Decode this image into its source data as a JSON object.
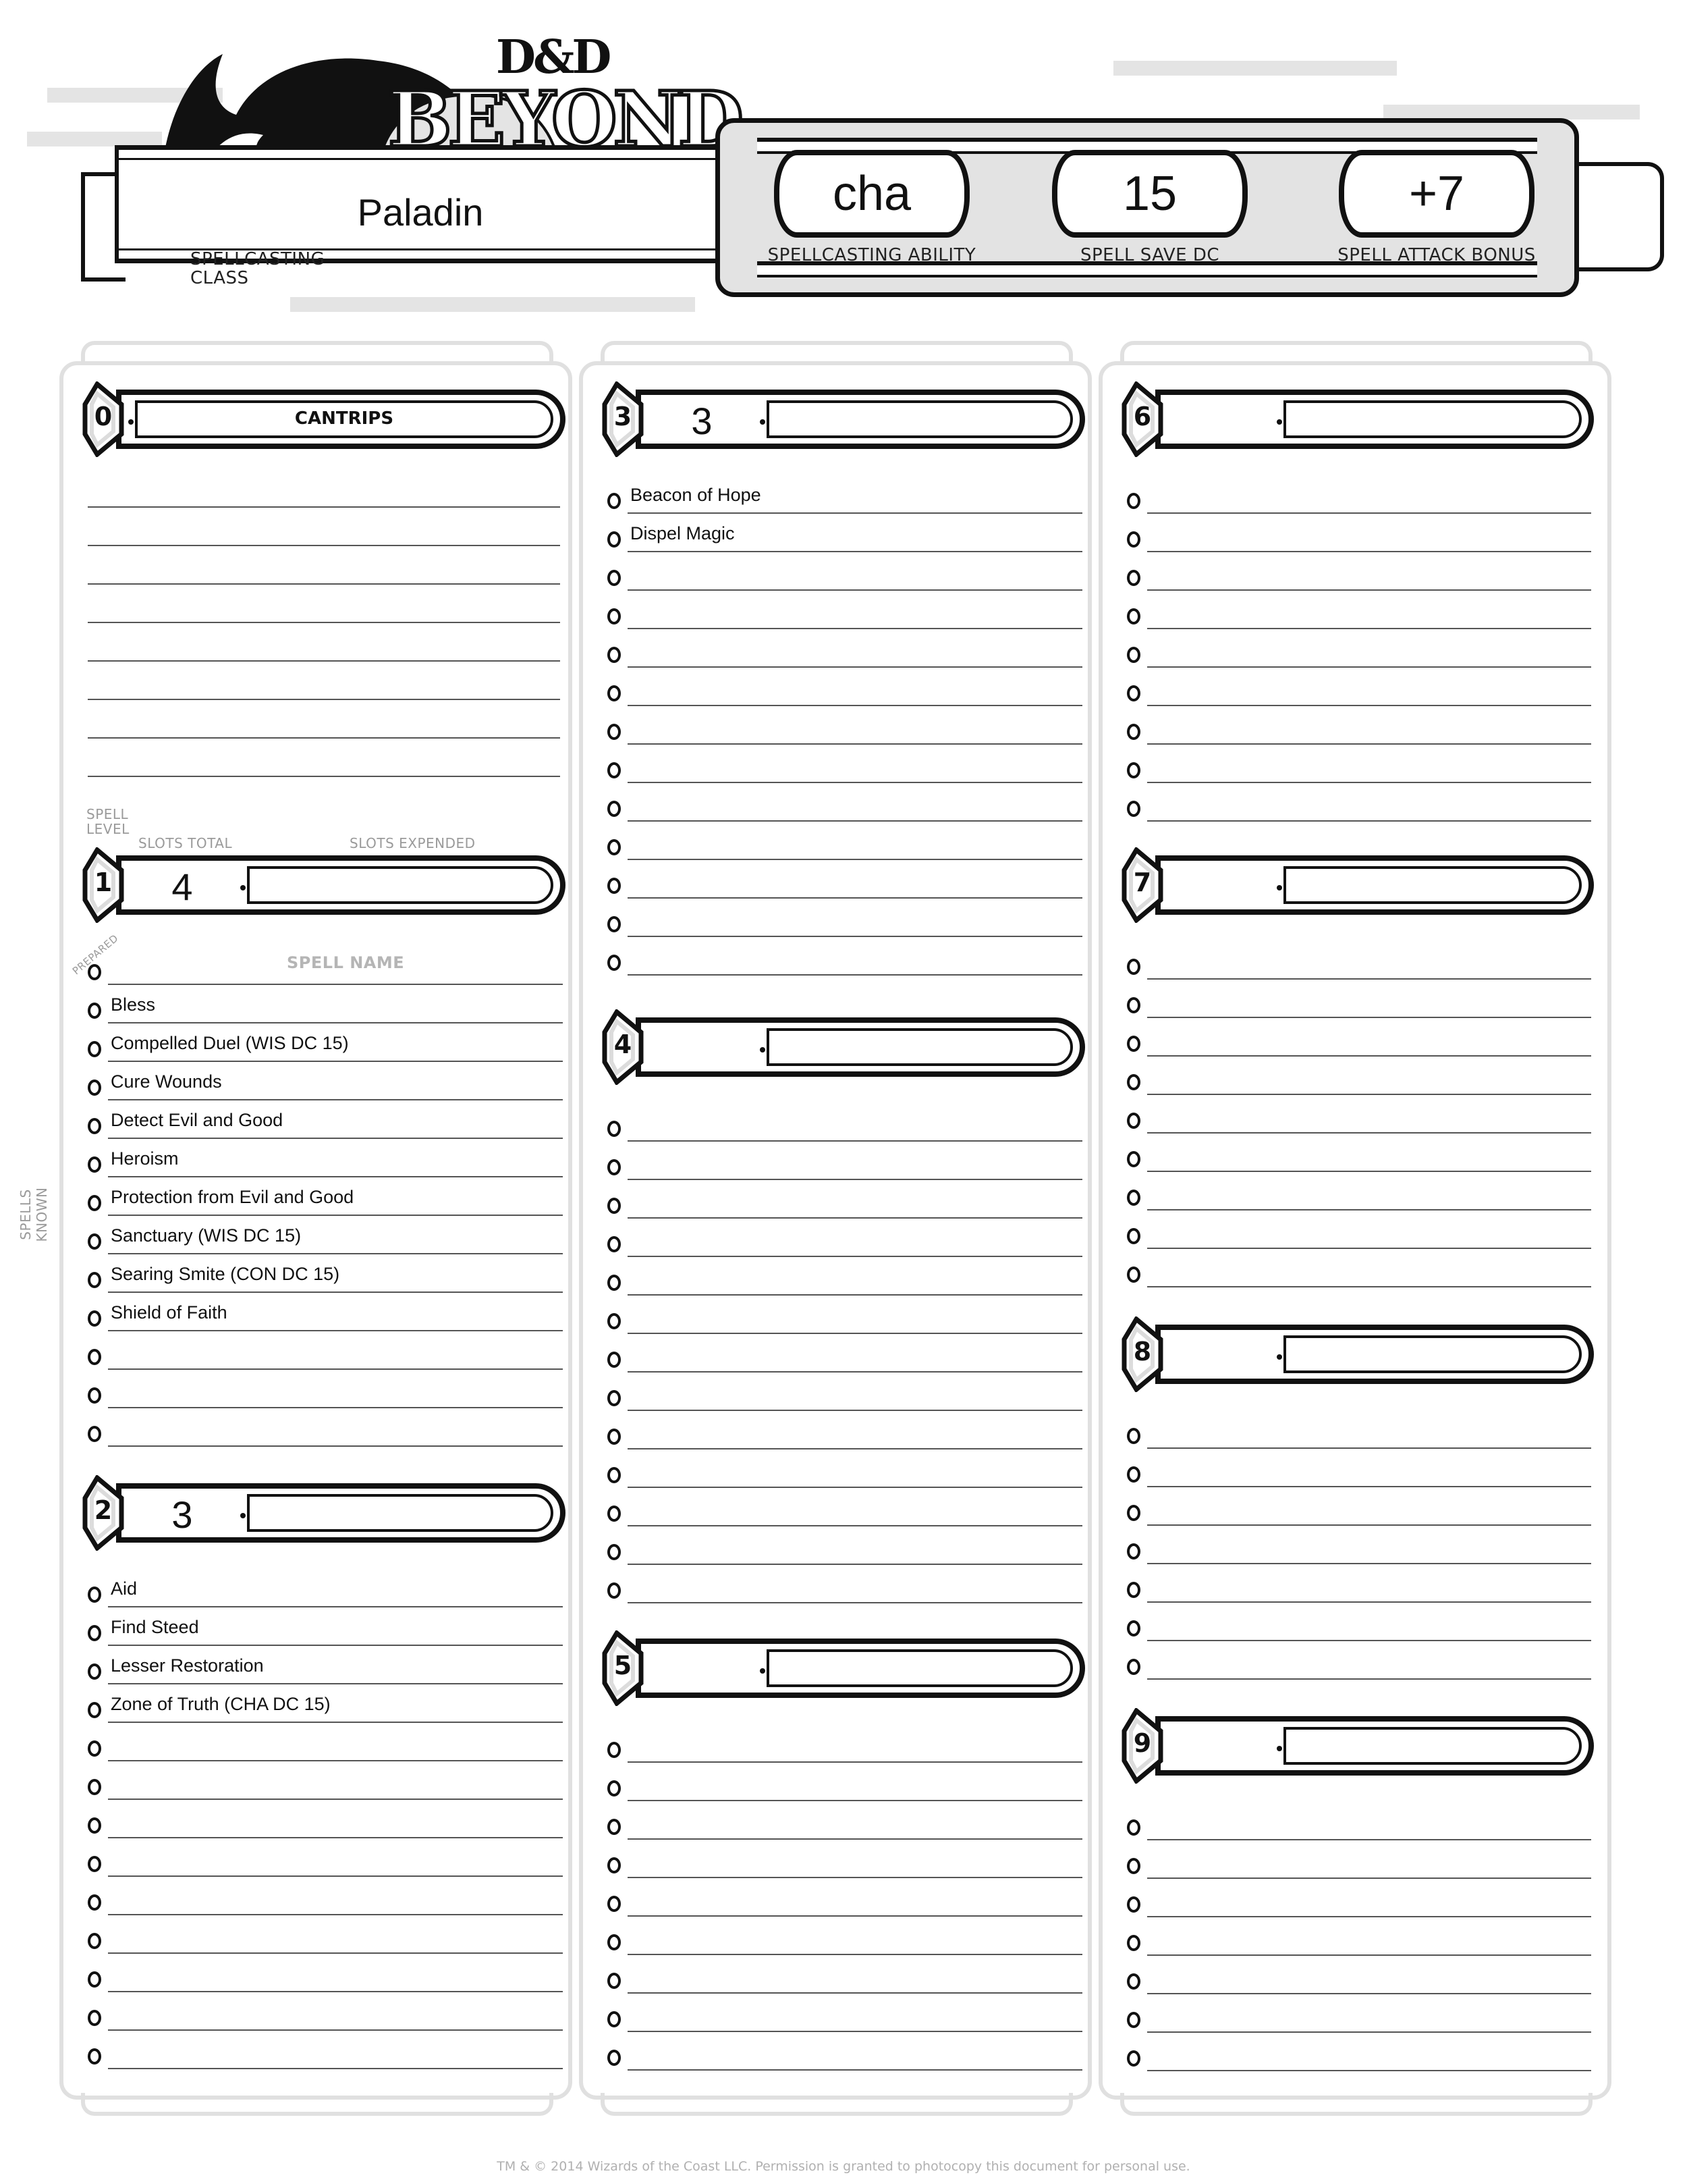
{
  "header": {
    "logo_top": "D&D",
    "logo_bottom": "BEYOND",
    "spellcasting_class": {
      "label": "SPELLCASTING CLASS",
      "value": "Paladin"
    },
    "stats": [
      {
        "label": "SPELLCASTING ABILITY",
        "value": "cha"
      },
      {
        "label": "SPELL SAVE DC",
        "value": "15"
      },
      {
        "label": "SPELL ATTACK BONUS",
        "value": "+7"
      }
    ]
  },
  "labels": {
    "spell_level": "SPELL LEVEL",
    "slots_total": "SLOTS TOTAL",
    "slots_expended": "SLOTS EXPENDED",
    "prepared": "PREPARED",
    "spell_name": "SPELL NAME",
    "spells_known": "SPELLS KNOWN",
    "cantrips": "CANTRIPS"
  },
  "cantrips": {
    "level": "0",
    "spells": [
      "",
      "",
      "",
      "",
      "",
      "",
      "",
      ""
    ]
  },
  "levels": [
    {
      "level": "1",
      "slots_total": "4",
      "slots_expended": "",
      "spells": [
        "",
        "Bless",
        "Compelled Duel (WIS DC 15)",
        "Cure Wounds",
        "Detect Evil and Good",
        "Heroism",
        "Protection from Evil and Good",
        "Sanctuary (WIS DC 15)",
        "Searing Smite (CON DC 15)",
        "Shield of Faith",
        "",
        "",
        ""
      ]
    },
    {
      "level": "2",
      "slots_total": "3",
      "slots_expended": "",
      "spells": [
        "Aid",
        "Find Steed",
        "Lesser Restoration",
        "Zone of Truth (CHA DC 15)",
        "",
        "",
        "",
        "",
        "",
        "",
        "",
        "",
        ""
      ]
    },
    {
      "level": "3",
      "slots_total": "3",
      "slots_expended": "",
      "spells": [
        "Beacon of Hope",
        "Dispel Magic",
        "",
        "",
        "",
        "",
        "",
        "",
        "",
        "",
        "",
        "",
        ""
      ]
    },
    {
      "level": "4",
      "slots_total": "",
      "slots_expended": "",
      "spells": [
        "",
        "",
        "",
        "",
        "",
        "",
        "",
        "",
        "",
        "",
        "",
        "",
        ""
      ]
    },
    {
      "level": "5",
      "slots_total": "",
      "slots_expended": "",
      "spells": [
        "",
        "",
        "",
        "",
        "",
        "",
        "",
        "",
        ""
      ]
    },
    {
      "level": "6",
      "slots_total": "",
      "slots_expended": "",
      "spells": [
        "",
        "",
        "",
        "",
        "",
        "",
        "",
        "",
        ""
      ]
    },
    {
      "level": "7",
      "slots_total": "",
      "slots_expended": "",
      "spells": [
        "",
        "",
        "",
        "",
        "",
        "",
        "",
        "",
        ""
      ]
    },
    {
      "level": "8",
      "slots_total": "",
      "slots_expended": "",
      "spells": [
        "",
        "",
        "",
        "",
        "",
        "",
        ""
      ]
    },
    {
      "level": "9",
      "slots_total": "",
      "slots_expended": "",
      "spells": [
        "",
        "",
        "",
        "",
        "",
        "",
        ""
      ]
    }
  ],
  "footer": "TM & © 2014 Wizards of the Coast LLC. Permission is granted to photocopy this document for personal use."
}
